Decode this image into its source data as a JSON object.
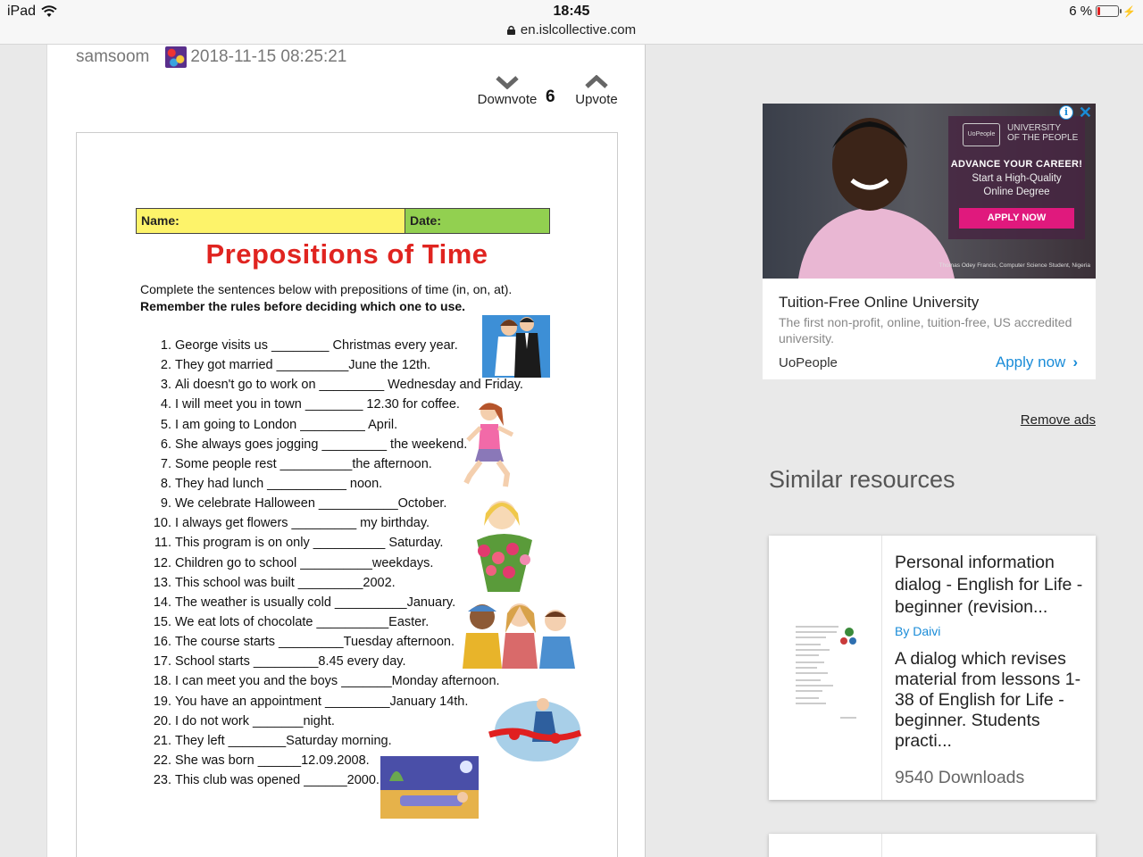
{
  "status": {
    "device": "iPad",
    "time": "18:45",
    "url": "en.islcollective.com",
    "battery": "6 %"
  },
  "meta": {
    "author": "samsoom",
    "date": "2018-11-15 08:25:21"
  },
  "votes": {
    "downvote": "Downvote",
    "upvote": "Upvote",
    "count": "6"
  },
  "worksheet": {
    "name_label": "Name:",
    "date_label": "Date:",
    "title": "Prepositions of Time",
    "instruction1": "Complete the sentences below with prepositions of time (in, on, at).",
    "instruction2": "Remember the rules before deciding which one to use.",
    "items": [
      {
        "n": "1.",
        "t": "George visits us ________ Christmas every year."
      },
      {
        "n": "2.",
        "t": "They got married __________June the 12th."
      },
      {
        "n": "3.",
        "t": "Ali doesn't go to work on _________ Wednesday and Friday."
      },
      {
        "n": "4.",
        "t": "I will meet you in town ________ 12.30 for coffee."
      },
      {
        "n": "5.",
        "t": "I am going to London _________ April."
      },
      {
        "n": "6.",
        "t": "She always goes jogging _________ the weekend."
      },
      {
        "n": "7.",
        "t": "Some people rest __________the afternoon."
      },
      {
        "n": "8.",
        "t": "They had lunch ___________ noon."
      },
      {
        "n": "9.",
        "t": "We celebrate Halloween ___________October."
      },
      {
        "n": "10.",
        "t": "I always get flowers _________ my birthday."
      },
      {
        "n": "11.",
        "t": "This program is on only __________ Saturday."
      },
      {
        "n": "12.",
        "t": "Children go to school __________weekdays."
      },
      {
        "n": "13.",
        "t": "This school was built _________2002."
      },
      {
        "n": "14.",
        "t": "The weather is usually cold __________January."
      },
      {
        "n": "15.",
        "t": "We eat lots of chocolate __________Easter."
      },
      {
        "n": "16.",
        "t": "The course starts _________Tuesday afternoon."
      },
      {
        "n": "17.",
        "t": "School starts _________8.45 every day."
      },
      {
        "n": "18.",
        "t": "I can meet you and the boys _______Monday afternoon."
      },
      {
        "n": "19.",
        "t": "You have an appointment _________January 14th."
      },
      {
        "n": "20.",
        "t": "I do not work _______night."
      },
      {
        "n": "21.",
        "t": "They left ________Saturday morning."
      },
      {
        "n": "22.",
        "t": "She was born ______12.09.2008."
      },
      {
        "n": "23.",
        "t": "This club was opened ______2000."
      }
    ]
  },
  "ad": {
    "university": "UNIVERSITY\nOF THE PEOPLE",
    "logo_text": "UoPeople",
    "headline": "ADVANCE YOUR CAREER!",
    "subline": "Start a High-Quality\nOnline Degree",
    "cta": "APPLY NOW",
    "caption": "Thomas Odey Francis, Computer Science Student, Nigeria",
    "title": "Tuition-Free Online University",
    "description": "The first non-profit, online, tuition-free, US accredited university.",
    "brand": "UoPeople",
    "apply": "Apply now",
    "remove_ads": "Remove ads",
    "colors": {
      "accent": "#1a8cd8",
      "cta": "#e0197d"
    }
  },
  "similar": {
    "heading": "Similar resources",
    "cards": [
      {
        "title": "Personal information dialog - English for Life - beginner (revision...",
        "author": "By Daivi",
        "description": "A dialog which revises material from lessons 1-38 of English for Life - beginner. Students practi...",
        "downloads": "9540 Downloads"
      }
    ]
  }
}
